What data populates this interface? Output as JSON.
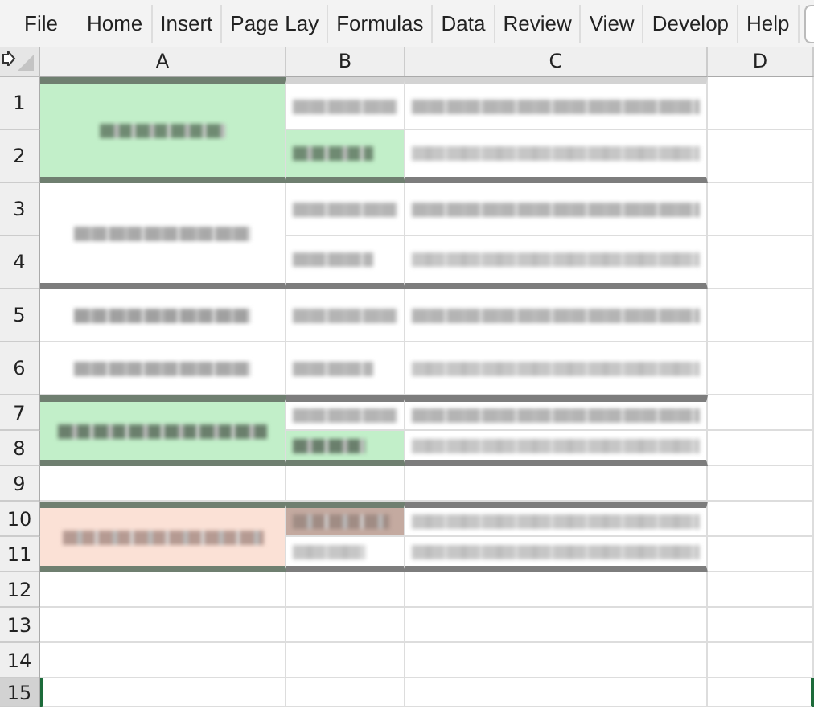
{
  "ribbon": {
    "tabs": [
      {
        "label": "File"
      },
      {
        "label": "Home"
      },
      {
        "label": "Insert"
      },
      {
        "label": "Page Lay"
      },
      {
        "label": "Formulas"
      },
      {
        "label": "Data"
      },
      {
        "label": "Review"
      },
      {
        "label": "View"
      },
      {
        "label": "Develop"
      },
      {
        "label": "Help"
      }
    ]
  },
  "columns": [
    {
      "label": "A"
    },
    {
      "label": "B"
    },
    {
      "label": "C"
    },
    {
      "label": "D"
    }
  ],
  "rows": [
    {
      "label": "1",
      "selected": false
    },
    {
      "label": "2",
      "selected": false
    },
    {
      "label": "3",
      "selected": false
    },
    {
      "label": "4",
      "selected": false
    },
    {
      "label": "5",
      "selected": false
    },
    {
      "label": "6",
      "selected": false
    },
    {
      "label": "7",
      "selected": false
    },
    {
      "label": "8",
      "selected": false
    },
    {
      "label": "9",
      "selected": false
    },
    {
      "label": "10",
      "selected": false
    },
    {
      "label": "11",
      "selected": false
    },
    {
      "label": "12",
      "selected": false
    },
    {
      "label": "13",
      "selected": false
    },
    {
      "label": "14",
      "selected": false
    },
    {
      "label": "15",
      "selected": true
    }
  ],
  "fills": [
    {
      "color": "#c2efc9"
    },
    {
      "color": "#c2efc9"
    },
    {
      "color": "#c2efc9"
    },
    {
      "color": "#c2efc9"
    },
    {
      "color": "#fbe1d6"
    },
    {
      "color": "#c4aaa0"
    }
  ]
}
